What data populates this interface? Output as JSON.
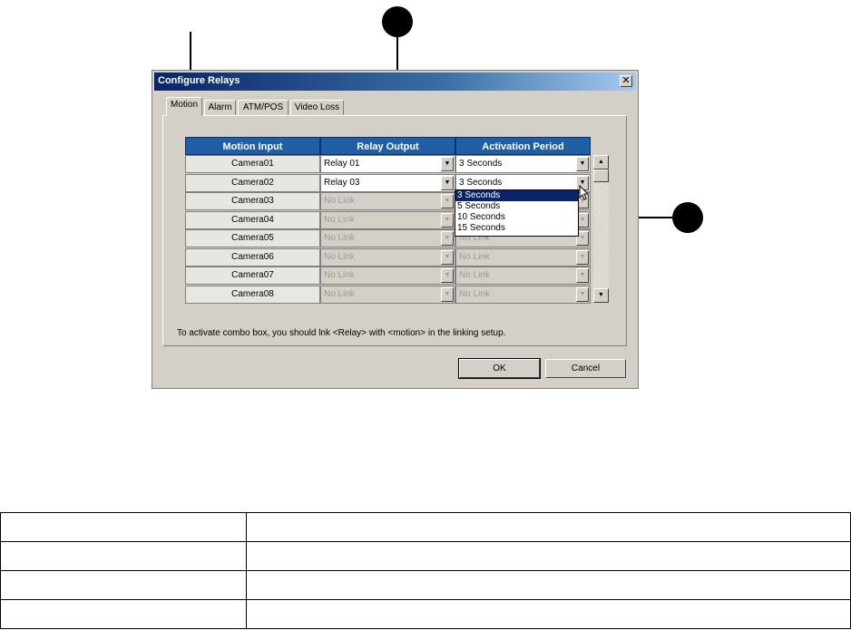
{
  "dialog": {
    "title": "Configure Relays",
    "close_label": "✕",
    "tabs": [
      {
        "label": "Motion",
        "active": true
      },
      {
        "label": "Alarm",
        "active": false
      },
      {
        "label": "ATM/POS",
        "active": false
      },
      {
        "label": "Video Loss",
        "active": false
      }
    ],
    "headers": [
      "Motion Input",
      "Relay Output",
      "Activation Period"
    ],
    "rows": [
      {
        "input": "Camera01",
        "relay": "Relay 01",
        "period": "3 Seconds",
        "enabled": true
      },
      {
        "input": "Camera02",
        "relay": "Relay 03",
        "period": "3 Seconds",
        "enabled": true
      },
      {
        "input": "Camera03",
        "relay": "No Link",
        "period": "",
        "enabled": false
      },
      {
        "input": "Camera04",
        "relay": "No Link",
        "period": "",
        "enabled": false
      },
      {
        "input": "Camera05",
        "relay": "No Link",
        "period": "No Link",
        "enabled": false
      },
      {
        "input": "Camera06",
        "relay": "No Link",
        "period": "No Link",
        "enabled": false
      },
      {
        "input": "Camera07",
        "relay": "No Link",
        "period": "No Link",
        "enabled": false
      },
      {
        "input": "Camera08",
        "relay": "No Link",
        "period": "No Link",
        "enabled": false
      }
    ],
    "dropdown_options": [
      "3 Seconds",
      "5 Seconds",
      "10 Seconds",
      "15 Seconds"
    ],
    "dropdown_selected": "3 Seconds",
    "hint": "To activate combo box, you should lnk <Relay> with <motion> in the linking setup.",
    "ok_label": "OK",
    "cancel_label": "Cancel"
  },
  "icons": {
    "dropdown_arrow": "▼",
    "scroll_up": "▲",
    "scroll_down": "▼"
  },
  "colors": {
    "header_blue": "#1f5fa8",
    "title_blue": "#0a246a",
    "dialog_gray": "#d4d0c8"
  },
  "bottom_table": {
    "rows": [
      [
        "",
        ""
      ],
      [
        "",
        ""
      ],
      [
        "",
        ""
      ],
      [
        "",
        ""
      ]
    ]
  }
}
